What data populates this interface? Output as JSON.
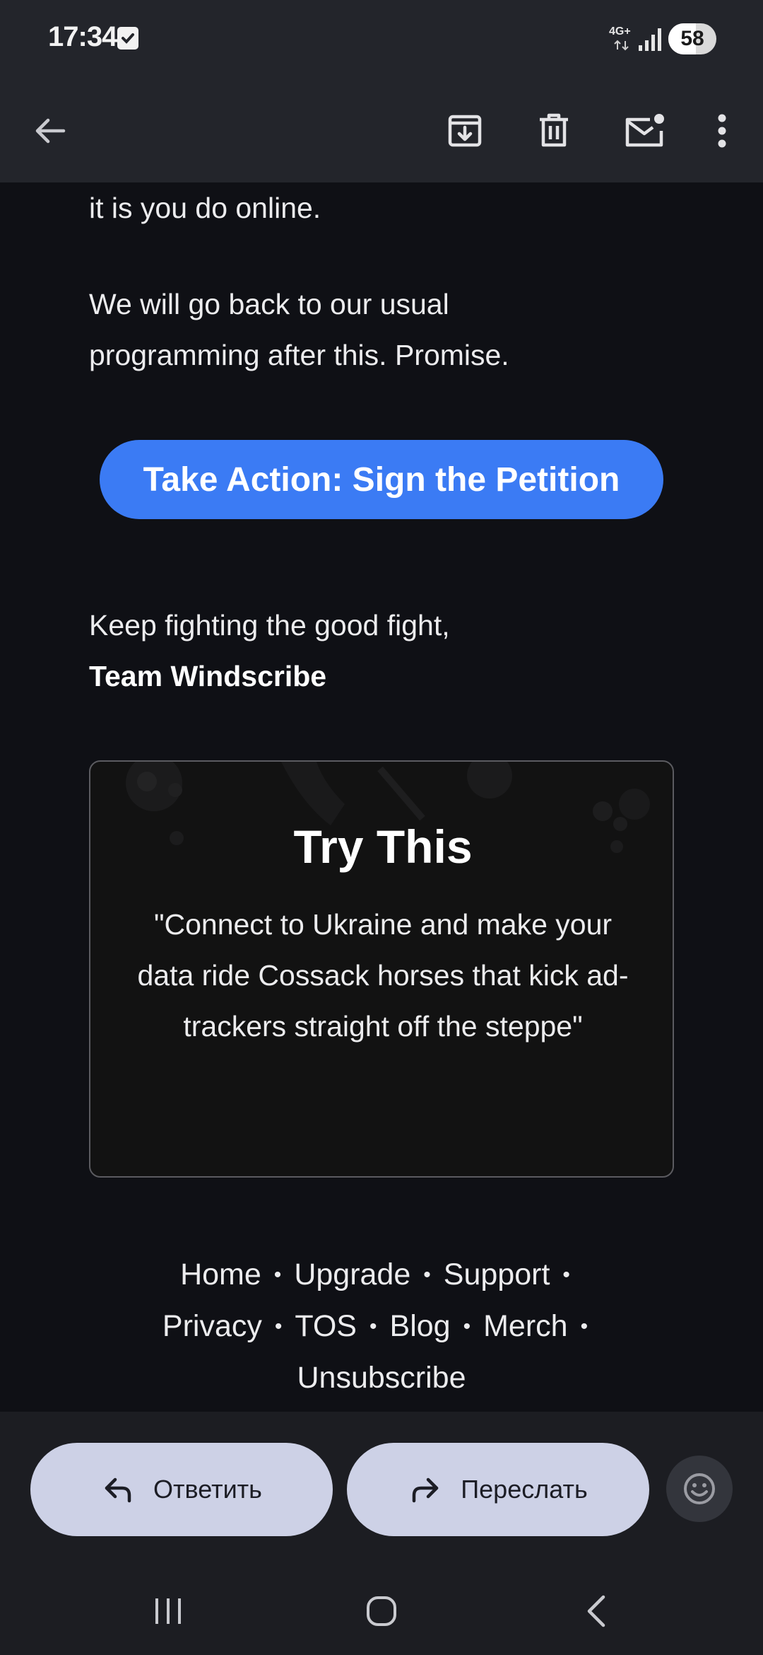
{
  "status_bar": {
    "time": "17:34",
    "network": "4G+",
    "battery_level": "58",
    "battery_fraction": 0.58
  },
  "toolbar": {
    "back_icon": "arrow-left-icon",
    "archive_icon": "archive-icon",
    "delete_icon": "trash-icon",
    "mark_unread_icon": "mail-unread-icon",
    "more_icon": "more-vert-icon"
  },
  "email": {
    "line_top": "it is you do online.",
    "paragraph": "We will go back to our usual programming after this. Promise.",
    "cta_label": "Take Action: Sign the Petition",
    "signoff": "Keep fighting the good fight,",
    "team": "Team Windscribe",
    "card": {
      "title": "Try This",
      "quote": "\"Connect to Ukraine and make your data ride Cossack horses that kick ad-trackers straight off the steppe\""
    },
    "footer_links": [
      "Home",
      "Upgrade",
      "Support",
      "Privacy",
      "TOS",
      "Blog",
      "Merch",
      "Unsubscribe"
    ]
  },
  "actions": {
    "reply_label": "Ответить",
    "forward_label": "Переслать",
    "emoji_icon": "emoji-icon"
  },
  "colors": {
    "accent": "#3b7bf4",
    "pill": "#cdd1e6",
    "bar": "#23252b",
    "background": "#0f1015"
  }
}
